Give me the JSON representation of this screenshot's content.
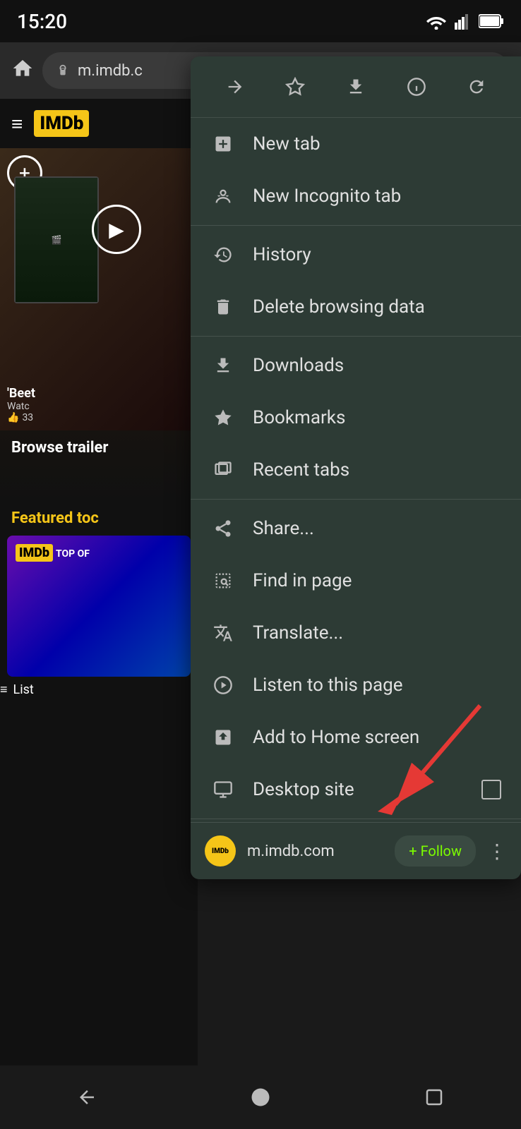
{
  "statusBar": {
    "time": "15:20"
  },
  "browserBar": {
    "url": "m.imdb.c",
    "homeLabel": "⌂"
  },
  "background": {
    "imdbLogo": "IMDb",
    "browseTrailers": "Browse trailer",
    "featuredToday": "Featured toc",
    "movieTitle": "'Beet",
    "watchLabel": "Watc",
    "likes": "33",
    "listLabel": "List",
    "topOf": "TOP OF"
  },
  "dropdown": {
    "toolbar": {
      "forward": "→",
      "bookmark": "☆",
      "download": "⬇",
      "info": "ⓘ",
      "refresh": "↻"
    },
    "items": [
      {
        "id": "new-tab",
        "icon": "new-tab",
        "label": "New tab"
      },
      {
        "id": "new-incognito-tab",
        "icon": "incognito",
        "label": "New Incognito tab"
      },
      {
        "id": "history",
        "icon": "history",
        "label": "History"
      },
      {
        "id": "delete-browsing-data",
        "icon": "delete",
        "label": "Delete browsing data"
      },
      {
        "id": "downloads",
        "icon": "downloads",
        "label": "Downloads"
      },
      {
        "id": "bookmarks",
        "icon": "bookmarks",
        "label": "Bookmarks"
      },
      {
        "id": "recent-tabs",
        "icon": "recent-tabs",
        "label": "Recent tabs"
      },
      {
        "id": "share",
        "icon": "share",
        "label": "Share..."
      },
      {
        "id": "find-in-page",
        "icon": "find",
        "label": "Find in page"
      },
      {
        "id": "translate",
        "icon": "translate",
        "label": "Translate..."
      },
      {
        "id": "listen-to-page",
        "icon": "listen",
        "label": "Listen to this page"
      },
      {
        "id": "add-to-home",
        "icon": "add-home",
        "label": "Add to Home screen"
      },
      {
        "id": "desktop-site",
        "icon": "desktop",
        "label": "Desktop site",
        "hasCheckbox": true
      }
    ],
    "bottom": {
      "siteLogoText": "IMDb",
      "siteUrl": "m.imdb.com",
      "followLabel": "+ Follow",
      "moreIcon": "⋮"
    }
  },
  "navBar": {
    "back": "◀",
    "home": "●",
    "recent": "■"
  }
}
